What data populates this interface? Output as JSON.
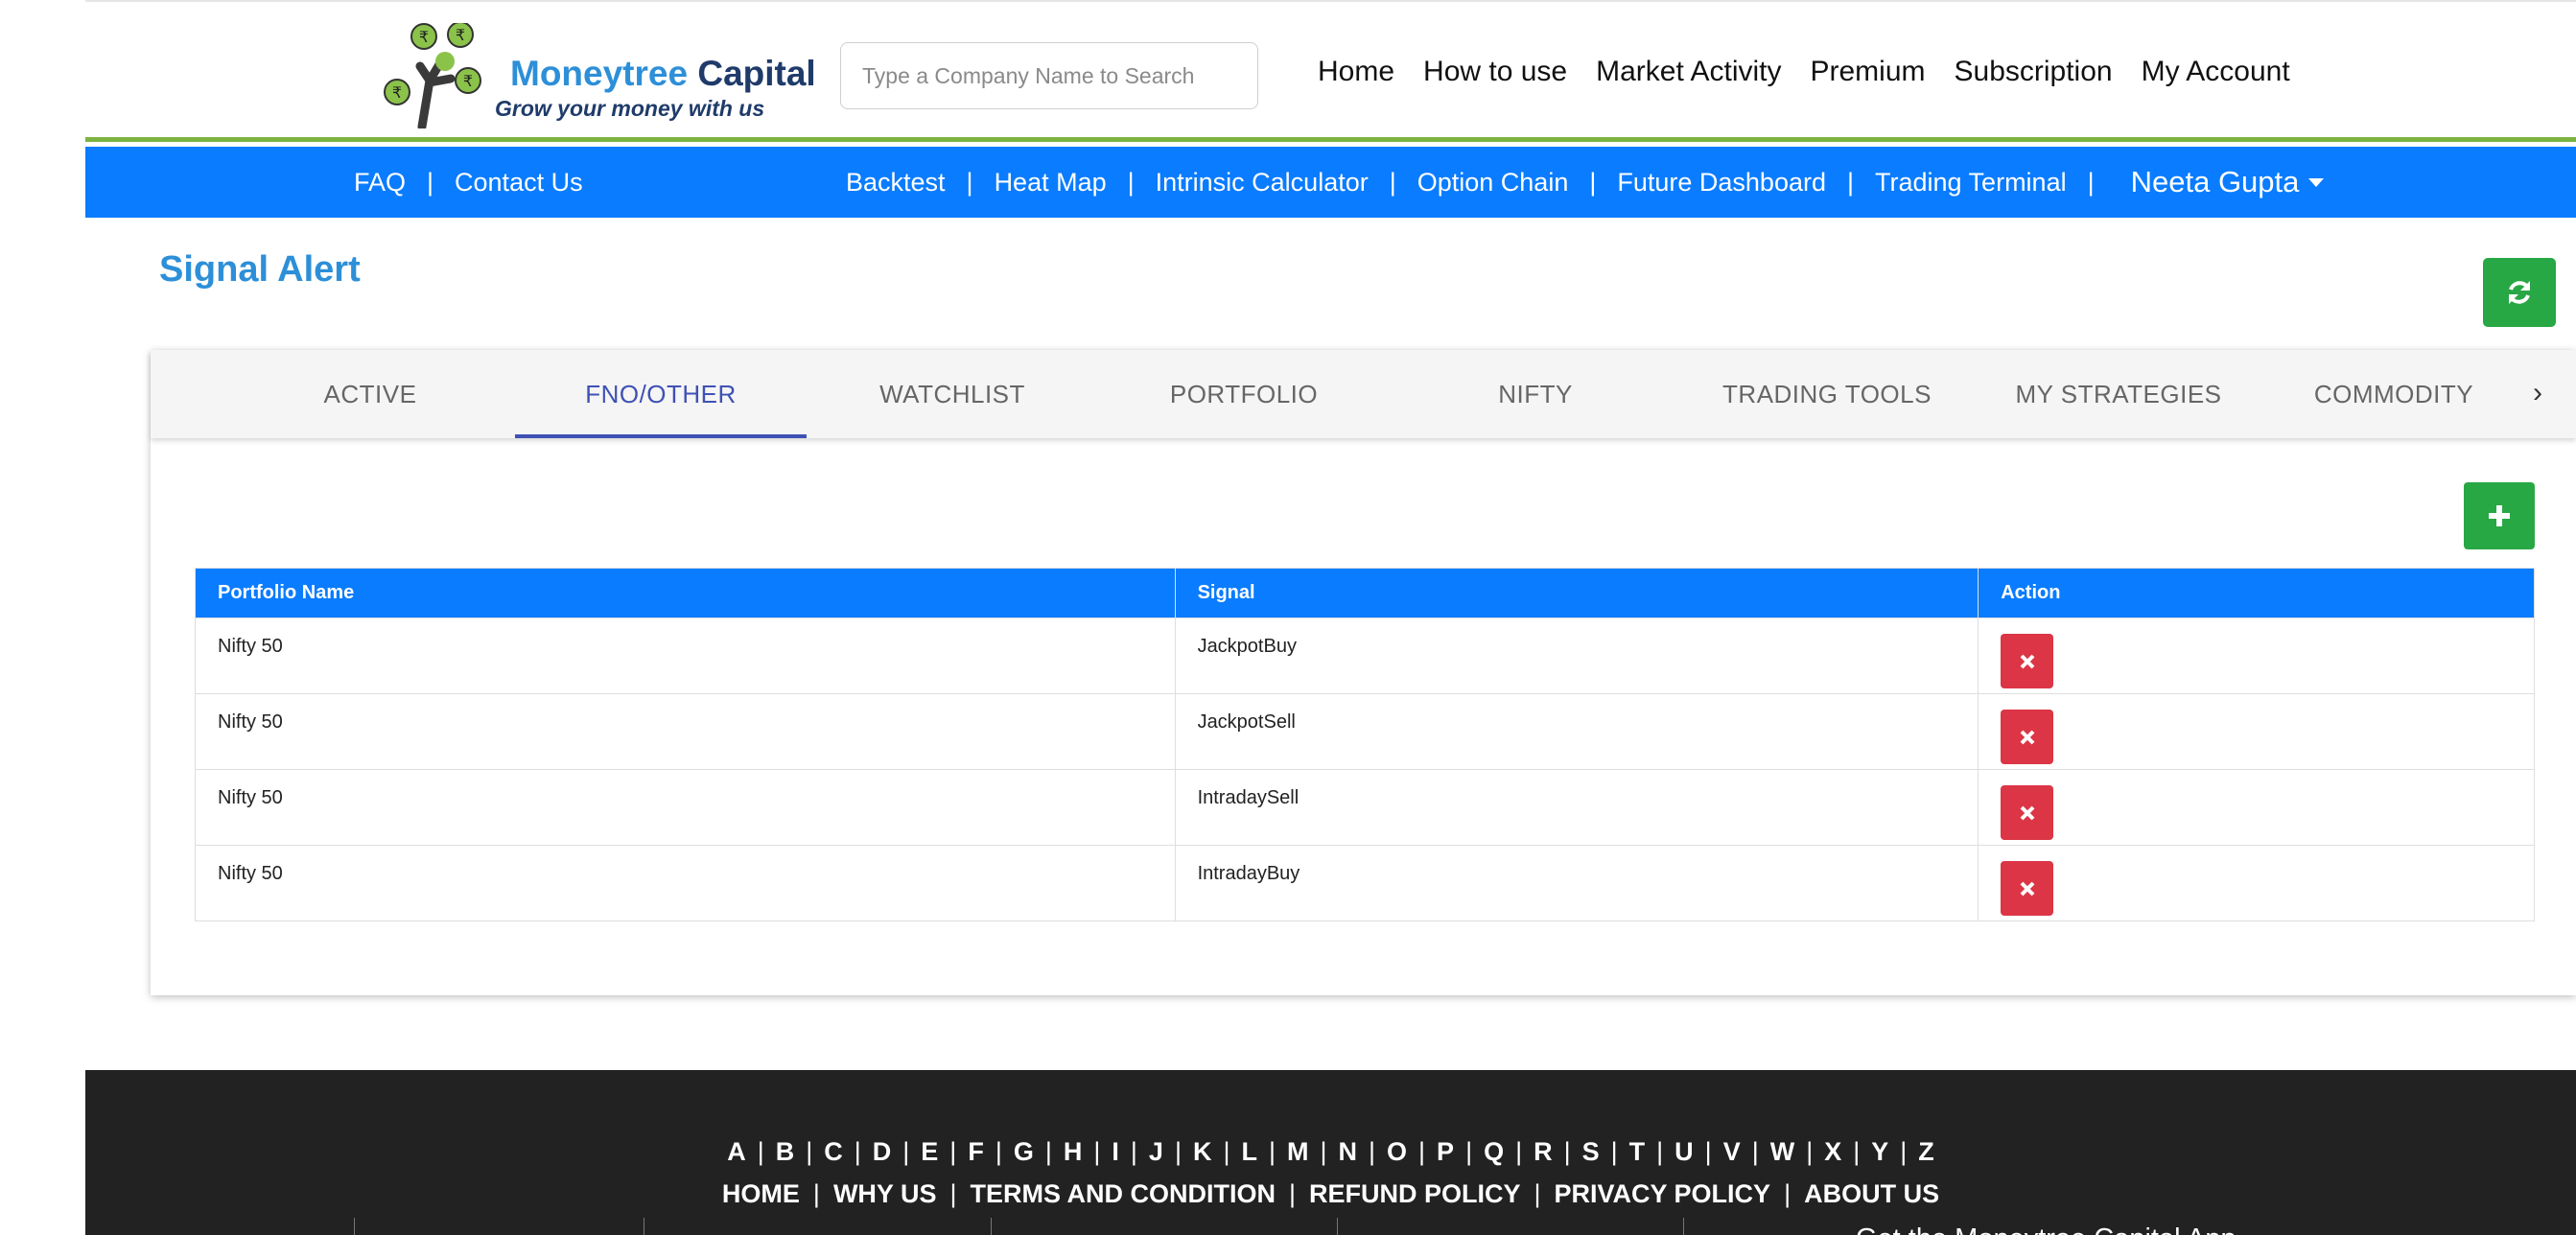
{
  "header": {
    "brand_part1": "Moneytree",
    "brand_part2": "Capital",
    "tagline": "Grow your money with us",
    "search_placeholder": "Type a Company Name to Search",
    "nav": [
      "Home",
      "How to use",
      "Market Activity",
      "Premium",
      "Subscription",
      "My Account"
    ]
  },
  "subnav": {
    "left": [
      "FAQ",
      "Contact Us"
    ],
    "right": [
      "Backtest",
      "Heat Map",
      "Intrinsic Calculator",
      "Option Chain",
      "Future Dashboard",
      "Trading Terminal"
    ],
    "user": "Neeta Gupta"
  },
  "page": {
    "title": "Signal Alert"
  },
  "tabs": [
    "ACTIVE",
    "FNO/OTHER",
    "WATCHLIST",
    "PORTFOLIO",
    "NIFTY",
    "TRADING TOOLS",
    "MY STRATEGIES",
    "COMMODITY"
  ],
  "active_tab": "FNO/OTHER",
  "table": {
    "headers": [
      "Portfolio Name",
      "Signal",
      "Action"
    ],
    "rows": [
      {
        "portfolio": "Nifty 50",
        "signal": "JackpotBuy"
      },
      {
        "portfolio": "Nifty 50",
        "signal": "JackpotSell"
      },
      {
        "portfolio": "Nifty 50",
        "signal": "IntradaySell"
      },
      {
        "portfolio": "Nifty 50",
        "signal": "IntradayBuy"
      }
    ]
  },
  "footer": {
    "letters": [
      "A",
      "B",
      "C",
      "D",
      "E",
      "F",
      "G",
      "H",
      "I",
      "J",
      "K",
      "L",
      "M",
      "N",
      "O",
      "P",
      "Q",
      "R",
      "S",
      "T",
      "U",
      "V",
      "W",
      "X",
      "Y",
      "Z"
    ],
    "links": [
      "HOME",
      "WHY US",
      "TERMS AND CONDITION",
      "REFUND POLICY",
      "PRIVACY POLICY",
      "ABOUT US"
    ],
    "app_text": "Get the Moneytree Capital App"
  },
  "colors": {
    "primary_blue": "#0a7cff",
    "brand_blue": "#2d8fd8",
    "success_green": "#28a745",
    "danger_red": "#dc3545",
    "tab_active": "#3f51b5",
    "footer_bg": "#222222"
  },
  "icons": {
    "refresh": "refresh-icon",
    "add": "plus-icon",
    "delete": "close-icon",
    "tab_next": "chevron-right-icon",
    "user_menu": "caret-down-icon"
  }
}
